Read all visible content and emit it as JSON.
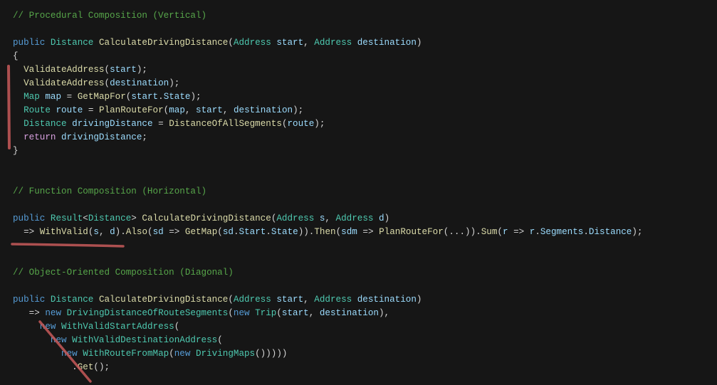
{
  "colors": {
    "background": "#161616",
    "comment": "#57a64a",
    "keyword": "#569cd6",
    "control": "#d8a0df",
    "type": "#4ec9b0",
    "method": "#dcdcaa",
    "identifier": "#9cdcfe",
    "punctuation": "#d4d4d4",
    "annotation": "#c85a5a"
  },
  "sections": [
    {
      "name": "procedural",
      "annotation": "vertical-bracket",
      "lines": [
        [
          [
            "comment",
            "// Procedural Composition (Vertical)"
          ]
        ],
        [],
        [
          [
            "kw",
            "public "
          ],
          [
            "type",
            "Distance "
          ],
          [
            "method",
            "CalculateDrivingDistance"
          ],
          [
            "punct",
            "("
          ],
          [
            "type",
            "Address "
          ],
          [
            "param",
            "start"
          ],
          [
            "punct",
            ", "
          ],
          [
            "type",
            "Address "
          ],
          [
            "param",
            "destination"
          ],
          [
            "punct",
            ")"
          ]
        ],
        [
          [
            "punct",
            "{"
          ]
        ],
        [
          [
            "punct",
            "  "
          ],
          [
            "method",
            "ValidateAddress"
          ],
          [
            "punct",
            "("
          ],
          [
            "param",
            "start"
          ],
          [
            "punct",
            ");"
          ]
        ],
        [
          [
            "punct",
            "  "
          ],
          [
            "method",
            "ValidateAddress"
          ],
          [
            "punct",
            "("
          ],
          [
            "param",
            "destination"
          ],
          [
            "punct",
            ");"
          ]
        ],
        [
          [
            "punct",
            "  "
          ],
          [
            "type",
            "Map "
          ],
          [
            "param",
            "map"
          ],
          [
            "punct",
            " = "
          ],
          [
            "method",
            "GetMapFor"
          ],
          [
            "punct",
            "("
          ],
          [
            "param",
            "start"
          ],
          [
            "punct",
            "."
          ],
          [
            "param",
            "State"
          ],
          [
            "punct",
            ");"
          ]
        ],
        [
          [
            "punct",
            "  "
          ],
          [
            "type",
            "Route "
          ],
          [
            "param",
            "route"
          ],
          [
            "punct",
            " = "
          ],
          [
            "method",
            "PlanRouteFor"
          ],
          [
            "punct",
            "("
          ],
          [
            "param",
            "map"
          ],
          [
            "punct",
            ", "
          ],
          [
            "param",
            "start"
          ],
          [
            "punct",
            ", "
          ],
          [
            "param",
            "destination"
          ],
          [
            "punct",
            ");"
          ]
        ],
        [
          [
            "punct",
            "  "
          ],
          [
            "type",
            "Distance "
          ],
          [
            "param",
            "drivingDistance"
          ],
          [
            "punct",
            " = "
          ],
          [
            "method",
            "DistanceOfAllSegments"
          ],
          [
            "punct",
            "("
          ],
          [
            "param",
            "route"
          ],
          [
            "punct",
            ");"
          ]
        ],
        [
          [
            "punct",
            "  "
          ],
          [
            "ctl",
            "return "
          ],
          [
            "param",
            "drivingDistance"
          ],
          [
            "punct",
            ";"
          ]
        ],
        [
          [
            "punct",
            "}"
          ]
        ],
        [],
        [],
        [
          [
            "comment",
            "// Function Composition (Horizontal)"
          ]
        ],
        [],
        [
          [
            "kw",
            "public "
          ],
          [
            "type",
            "Result"
          ],
          [
            "punct",
            "<"
          ],
          [
            "type",
            "Distance"
          ],
          [
            "punct",
            "> "
          ],
          [
            "method",
            "CalculateDrivingDistance"
          ],
          [
            "punct",
            "("
          ],
          [
            "type",
            "Address "
          ],
          [
            "param",
            "s"
          ],
          [
            "punct",
            ", "
          ],
          [
            "type",
            "Address "
          ],
          [
            "param",
            "d"
          ],
          [
            "punct",
            ")"
          ]
        ],
        [
          [
            "punct",
            "  => "
          ],
          [
            "method",
            "WithValid"
          ],
          [
            "punct",
            "("
          ],
          [
            "param",
            "s"
          ],
          [
            "punct",
            ", "
          ],
          [
            "param",
            "d"
          ],
          [
            "punct",
            ")."
          ],
          [
            "method",
            "Also"
          ],
          [
            "punct",
            "("
          ],
          [
            "param",
            "sd"
          ],
          [
            "punct",
            " => "
          ],
          [
            "method",
            "GetMap"
          ],
          [
            "punct",
            "("
          ],
          [
            "param",
            "sd"
          ],
          [
            "punct",
            "."
          ],
          [
            "param",
            "Start"
          ],
          [
            "punct",
            "."
          ],
          [
            "param",
            "State"
          ],
          [
            "punct",
            "))."
          ],
          [
            "method",
            "Then"
          ],
          [
            "punct",
            "("
          ],
          [
            "param",
            "sdm"
          ],
          [
            "punct",
            " => "
          ],
          [
            "method",
            "PlanRouteFor"
          ],
          [
            "punct",
            "(...))."
          ],
          [
            "method",
            "Sum"
          ],
          [
            "punct",
            "("
          ],
          [
            "param",
            "r"
          ],
          [
            "punct",
            " => "
          ],
          [
            "param",
            "r"
          ],
          [
            "punct",
            "."
          ],
          [
            "param",
            "Segments"
          ],
          [
            "punct",
            "."
          ],
          [
            "param",
            "Distance"
          ],
          [
            "punct",
            ");"
          ]
        ],
        [],
        [],
        [
          [
            "comment",
            "// Object-Oriented Composition (Diagonal)"
          ]
        ],
        [],
        [
          [
            "kw",
            "public "
          ],
          [
            "type",
            "Distance "
          ],
          [
            "method",
            "CalculateDrivingDistance"
          ],
          [
            "punct",
            "("
          ],
          [
            "type",
            "Address "
          ],
          [
            "param",
            "start"
          ],
          [
            "punct",
            ", "
          ],
          [
            "type",
            "Address "
          ],
          [
            "param",
            "destination"
          ],
          [
            "punct",
            ")"
          ]
        ],
        [
          [
            "punct",
            "   => "
          ],
          [
            "kw",
            "new "
          ],
          [
            "type",
            "DrivingDistanceOfRouteSegments"
          ],
          [
            "punct",
            "("
          ],
          [
            "kw",
            "new "
          ],
          [
            "type",
            "Trip"
          ],
          [
            "punct",
            "("
          ],
          [
            "param",
            "start"
          ],
          [
            "punct",
            ", "
          ],
          [
            "param",
            "destination"
          ],
          [
            "punct",
            "),"
          ]
        ],
        [
          [
            "punct",
            "     "
          ],
          [
            "kw",
            "new "
          ],
          [
            "type",
            "WithValidStartAddress"
          ],
          [
            "punct",
            "("
          ]
        ],
        [
          [
            "punct",
            "       "
          ],
          [
            "kw",
            "new "
          ],
          [
            "type",
            "WithValidDestinationAddress"
          ],
          [
            "punct",
            "("
          ]
        ],
        [
          [
            "punct",
            "         "
          ],
          [
            "kw",
            "new "
          ],
          [
            "type",
            "WithRouteFromMap"
          ],
          [
            "punct",
            "("
          ],
          [
            "kw",
            "new "
          ],
          [
            "type",
            "DrivingMaps"
          ],
          [
            "punct",
            "()))))"
          ]
        ],
        [
          [
            "punct",
            "           ."
          ],
          [
            "method",
            "Get"
          ],
          [
            "punct",
            "();"
          ]
        ]
      ]
    }
  ]
}
